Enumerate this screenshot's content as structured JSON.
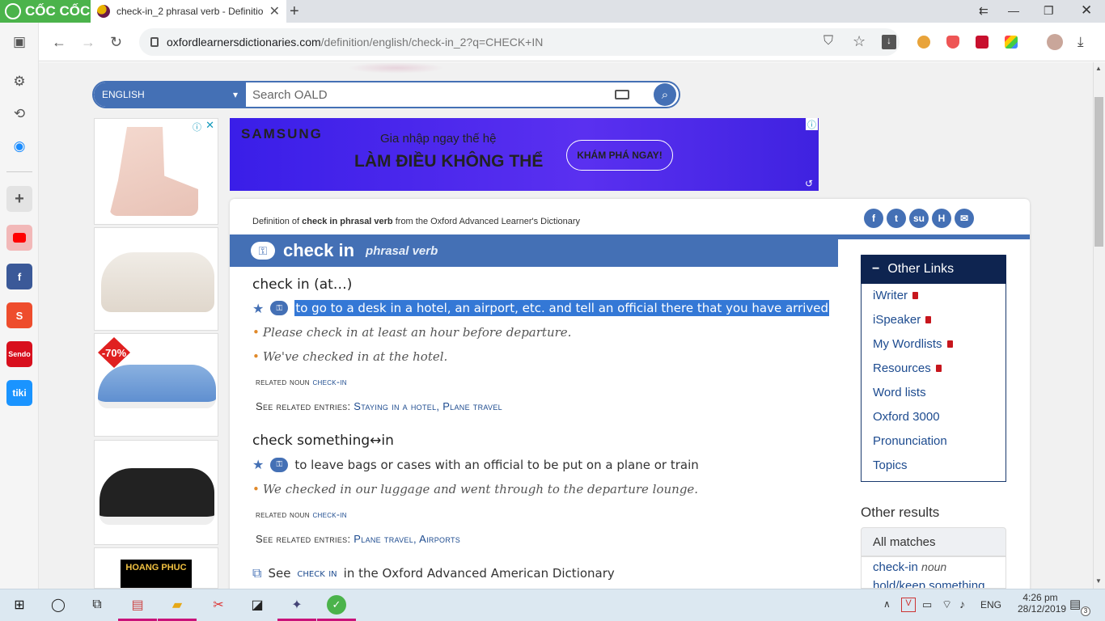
{
  "browser": {
    "brand": "CỐC CỐC",
    "tab_title": "check-in_2 phrasal verb - Definitio",
    "url_host": "oxfordlearnersdictionaries.com",
    "url_path": "/definition/english/check-in_2?q=CHECK+IN"
  },
  "search": {
    "language": "ENGLISH",
    "placeholder": "Search OALD"
  },
  "ad": {
    "brand": "SAMSUNG",
    "line1": "Gia nhập ngay thế hệ",
    "line2": "LÀM ĐIỀU KHÔNG THỂ",
    "cta": "KHÁM PHÁ NGAY!",
    "discount": "-70%",
    "shop_logo": "HOANG PHUC"
  },
  "entry": {
    "definition_prefix": "Definition of",
    "definition_word": "check in phrasal verb",
    "definition_suffix": "from the Oxford Advanced Learner's Dictionary",
    "headword": "check in",
    "pos": "phrasal verb",
    "senses": [
      {
        "title": "check in (at…)",
        "definition": "to go to a desk in a hotel, an airport, etc. and tell an official there that you have arrived",
        "examples": [
          "Please check in at least an hour before departure.",
          "We've checked in at the hotel."
        ],
        "related_label": "related noun",
        "related_noun": "check-in",
        "see_label": "See related entries:",
        "see_entries": "Staying in a hotel, Plane travel"
      },
      {
        "title": "check something↔in",
        "definition": "to leave bags or cases with an official to be put on a plane or train",
        "examples": [
          "We checked in our luggage and went through to the departure lounge."
        ],
        "related_label": "related noun",
        "related_noun": "check-in",
        "see_label": "See related entries:",
        "see_entries": "Plane travel, Airports"
      }
    ],
    "american_see": "See",
    "american_link": "check in",
    "american_suffix": "in the Oxford Advanced American Dictionary"
  },
  "other_links": {
    "title": "Other Links",
    "items": [
      "iWriter",
      "iSpeaker",
      "My Wordlists",
      "Resources",
      "Word lists",
      "Oxford 3000",
      "Pronunciation",
      "Topics"
    ]
  },
  "other_results": {
    "title": "Other results",
    "tab": "All matches",
    "first_word": "check-in",
    "first_pos": "noun",
    "second": "hold/keep something"
  },
  "taskbar": {
    "lang": "ENG",
    "time": "4:26 pm",
    "date": "28/12/2019",
    "notif": "3"
  },
  "colors": {
    "oxford_blue": "#4470b5",
    "navy": "#0e2450",
    "coccoc_green": "#4bb34b",
    "selection": "#3478d6"
  }
}
